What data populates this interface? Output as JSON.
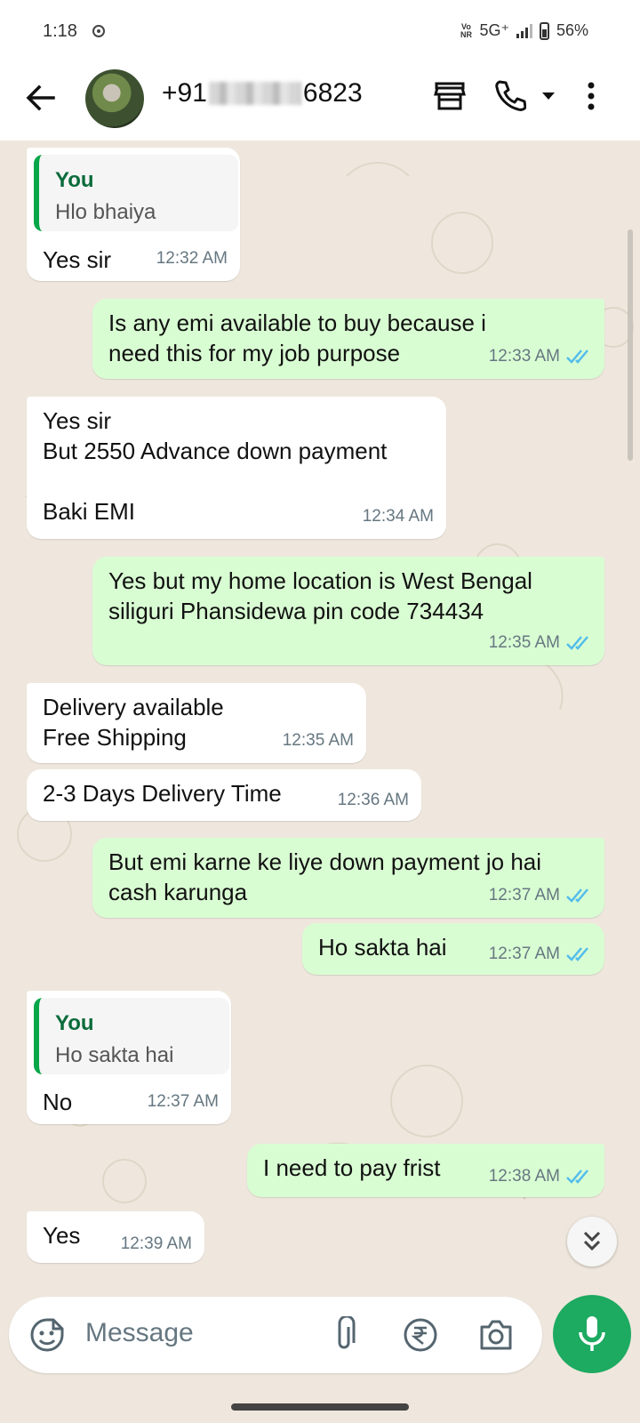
{
  "status_bar": {
    "time": "1:18",
    "network": "5G⁺",
    "volte": "Vo NR",
    "battery": "56%"
  },
  "header": {
    "phone_prefix": "+91",
    "phone_suffix": "6823"
  },
  "messages": [
    {
      "dir": "in",
      "quote_sender": "You",
      "quote_text": "Hlo bhaiya",
      "text": "Yes sir",
      "time": "12:32 AM"
    },
    {
      "dir": "out",
      "text": "Is any emi available to buy because i\nneed this for my job purpose",
      "time": "12:33 AM"
    },
    {
      "dir": "in",
      "text": "Yes sir\nBut 2550 Advance down payment\n\nBaki EMI",
      "time": "12:34 AM"
    },
    {
      "dir": "out",
      "text": "Yes but my home location is West Bengal\nsiliguri Phansidewa pin code 734434",
      "time": "12:35 AM"
    },
    {
      "dir": "in",
      "text": "Delivery available\nFree Shipping",
      "time": "12:35 AM"
    },
    {
      "dir": "in",
      "text": "2-3 Days Delivery Time",
      "time": "12:36 AM"
    },
    {
      "dir": "out",
      "text": "But emi karne ke liye down payment jo hai\ncash karunga",
      "time": "12:37 AM"
    },
    {
      "dir": "out",
      "text": "Ho sakta hai",
      "time": "12:37 AM"
    },
    {
      "dir": "in",
      "quote_sender": "You",
      "quote_text": "Ho sakta hai",
      "text": "No",
      "time": "12:37 AM"
    },
    {
      "dir": "out",
      "text": "I need to pay frist",
      "time": "12:38 AM"
    },
    {
      "dir": "in",
      "text": "Yes",
      "time": "12:39 AM"
    }
  ],
  "input": {
    "placeholder": "Message"
  },
  "colors": {
    "incoming": "#ffffff",
    "outgoing": "#d9fdd3",
    "accent": "#1daa61",
    "read_ticks": "#53bdeb"
  }
}
